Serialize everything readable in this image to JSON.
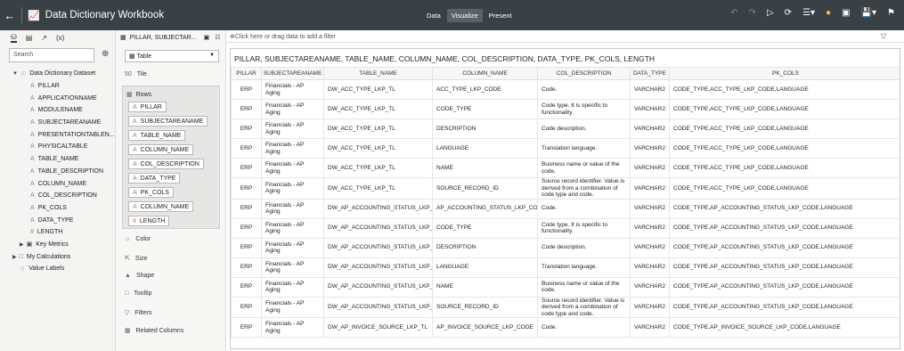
{
  "topbar": {
    "back_icon": "back-arrow-icon",
    "title": "Data Dictionary Workbook",
    "modes": [
      "Data",
      "Visualize",
      "Present"
    ],
    "active_mode": "Visualize"
  },
  "left_panel": {
    "tabs": [
      "data-icon",
      "chart-icon",
      "analytics-icon",
      "(x)"
    ],
    "tab_label_expr": "(x)",
    "search_placeholder": "Search",
    "dataset": "Data Dictionary Dataset",
    "columns": [
      "PILLAR",
      "APPLICATIONNAME",
      "MODULENAME",
      "SUBJECTAREANAME",
      "PRESENTATIONTABLEN...",
      "PHYSICALTABLE",
      "TABLE_NAME",
      "TABLE_DESCRIPTION",
      "COLUMN_NAME",
      "COL_DESCRIPTION",
      "PK_COLS",
      "DATA_TYPE",
      "LENGTH"
    ],
    "groups": [
      "Key Metrics",
      "My Calculations",
      "Value Labels"
    ]
  },
  "grammar": {
    "header": "PILLAR, SUBJECTAR...",
    "viz_type": "Table",
    "tile_label": "Tile",
    "rows_label": "Rows",
    "row_pills": [
      "PILLAR",
      "SUBJECTAREANAME",
      "TABLE_NAME",
      "COLUMN_NAME",
      "COL_DESCRIPTION",
      "DATA_TYPE",
      "PK_COLS",
      "COLUMN_NAME",
      "LENGTH"
    ],
    "items": [
      "Color",
      "Size",
      "Shape",
      "Tooltip",
      "Filters",
      "Related Columns"
    ]
  },
  "filterbar": {
    "placeholder": "Click here or drag data to add a filter"
  },
  "viz": {
    "title": "PILLAR, SUBJECTAREANAME, TABLE_NAME, COLUMN_NAME, COL_DESCRIPTION, DATA_TYPE, PK_COLS, LENGTH",
    "headers": [
      "PILLAR",
      "SUBJECTAREANAME",
      "TABLE_NAME",
      "COLUMN_NAME",
      "COL_DESCRIPTION",
      "DATA_TYPE",
      "PK_COLS"
    ],
    "rows": [
      [
        "ERP",
        "Financials - AP Aging",
        "DW_ACC_TYPE_LKP_TL",
        "ACC_TYPE_LKP_CODE",
        "Code.",
        "VARCHAR2",
        "CODE_TYPE,ACC_TYPE_LKP_CODE,LANGUAGE"
      ],
      [
        "ERP",
        "Financials - AP Aging",
        "DW_ACC_TYPE_LKP_TL",
        "CODE_TYPE",
        "Code type. It is specific to functionality.",
        "VARCHAR2",
        "CODE_TYPE,ACC_TYPE_LKP_CODE,LANGUAGE"
      ],
      [
        "ERP",
        "Financials - AP Aging",
        "DW_ACC_TYPE_LKP_TL",
        "DESCRIPTION",
        "Code description.",
        "VARCHAR2",
        "CODE_TYPE,ACC_TYPE_LKP_CODE,LANGUAGE"
      ],
      [
        "ERP",
        "Financials - AP Aging",
        "DW_ACC_TYPE_LKP_TL",
        "LANGUAGE",
        "Translation language.",
        "VARCHAR2",
        "CODE_TYPE,ACC_TYPE_LKP_CODE,LANGUAGE"
      ],
      [
        "ERP",
        "Financials - AP Aging",
        "DW_ACC_TYPE_LKP_TL",
        "NAME",
        "Business name or value of the code.",
        "VARCHAR2",
        "CODE_TYPE,ACC_TYPE_LKP_CODE,LANGUAGE"
      ],
      [
        "ERP",
        "Financials - AP Aging",
        "DW_ACC_TYPE_LKP_TL",
        "SOURCE_RECORD_ID",
        "Source record identifier. Value is derived from a combination of code type and code.",
        "VARCHAR2",
        "CODE_TYPE,ACC_TYPE_LKP_CODE,LANGUAGE"
      ],
      [
        "ERP",
        "Financials - AP Aging",
        "DW_AP_ACCOUNTING_STATUS_LKP_TL",
        "AP_ACCOUNTING_STATUS_LKP_CODE",
        "Code.",
        "VARCHAR2",
        "CODE_TYPE,AP_ACCOUNTING_STATUS_LKP_CODE,LANGUAGE"
      ],
      [
        "ERP",
        "Financials - AP Aging",
        "DW_AP_ACCOUNTING_STATUS_LKP_TL",
        "CODE_TYPE",
        "Code type. It is specific to functionality.",
        "VARCHAR2",
        "CODE_TYPE,AP_ACCOUNTING_STATUS_LKP_CODE,LANGUAGE"
      ],
      [
        "ERP",
        "Financials - AP Aging",
        "DW_AP_ACCOUNTING_STATUS_LKP_TL",
        "DESCRIPTION",
        "Code description.",
        "VARCHAR2",
        "CODE_TYPE,AP_ACCOUNTING_STATUS_LKP_CODE,LANGUAGE"
      ],
      [
        "ERP",
        "Financials - AP Aging",
        "DW_AP_ACCOUNTING_STATUS_LKP_TL",
        "LANGUAGE",
        "Translation language.",
        "VARCHAR2",
        "CODE_TYPE,AP_ACCOUNTING_STATUS_LKP_CODE,LANGUAGE"
      ],
      [
        "ERP",
        "Financials - AP Aging",
        "DW_AP_ACCOUNTING_STATUS_LKP_TL",
        "NAME",
        "Business name or value of the code.",
        "VARCHAR2",
        "CODE_TYPE,AP_ACCOUNTING_STATUS_LKP_CODE,LANGUAGE"
      ],
      [
        "ERP",
        "Financials - AP Aging",
        "DW_AP_ACCOUNTING_STATUS_LKP_TL",
        "SOURCE_RECORD_ID",
        "Source record identifier. Value is derived from a combination of code type and code.",
        "VARCHAR2",
        "CODE_TYPE,AP_ACCOUNTING_STATUS_LKP_CODE,LANGUAGE"
      ],
      [
        "ERP",
        "Financials - AP Aging",
        "DW_AP_INVOICE_SOURCE_LKP_TL",
        "AP_INVOICE_SOURCE_LKP_CODE",
        "Code.",
        "VARCHAR2",
        "CODE_TYPE,AP_INVOICE_SOURCE_LKP_CODE,LANGUAGE"
      ]
    ]
  }
}
